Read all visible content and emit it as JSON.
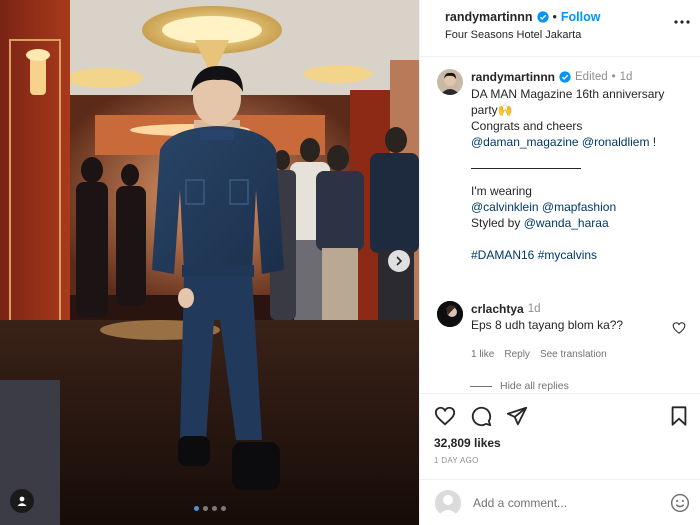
{
  "post": {
    "username": "randymartinnn",
    "separator": "•",
    "follow_label": "Follow",
    "location": "Four Seasons Hotel Jakarta"
  },
  "caption": {
    "username": "randymartinnn",
    "edited": "Edited",
    "dot": "•",
    "age": "1d",
    "line1": "DA MAN Magazine 16th anniversary party🙌",
    "line2": "Congrats and cheers",
    "mention1": "@daman_magazine",
    "mention2": "@ronaldliem",
    "exclaim": " !",
    "wearing": "I'm wearing",
    "mention3": "@calvinklein",
    "mention4": "@mapfashion",
    "styled": "Styled by ",
    "mention5": "@wanda_haraa",
    "hashtag1": "#DAMAN16",
    "hashtag2": "#mycalvins"
  },
  "comment": {
    "username": "crlachtya",
    "age": "1d",
    "text": "Eps 8 udh tayang blom ka??",
    "likes": "1 like",
    "reply": "Reply",
    "translation": "See translation",
    "hide_replies": "Hide all replies"
  },
  "stats": {
    "likes": "32,809 likes",
    "when": "1 DAY AGO"
  },
  "add_comment": {
    "placeholder": "Add a comment..."
  },
  "carousel": {
    "total": 4,
    "active": 1
  },
  "icons": {
    "verified": "verified-badge-icon",
    "more": "more-options-icon",
    "like": "heart-icon",
    "comment": "comment-icon",
    "share": "send-icon",
    "save": "bookmark-icon",
    "emoji": "emoji-icon",
    "next": "chevron-right-icon",
    "tag": "user-tag-icon"
  },
  "colors": {
    "accent": "#0095f6",
    "link": "#00376b",
    "muted": "#737373",
    "verified": "#0095f6"
  }
}
